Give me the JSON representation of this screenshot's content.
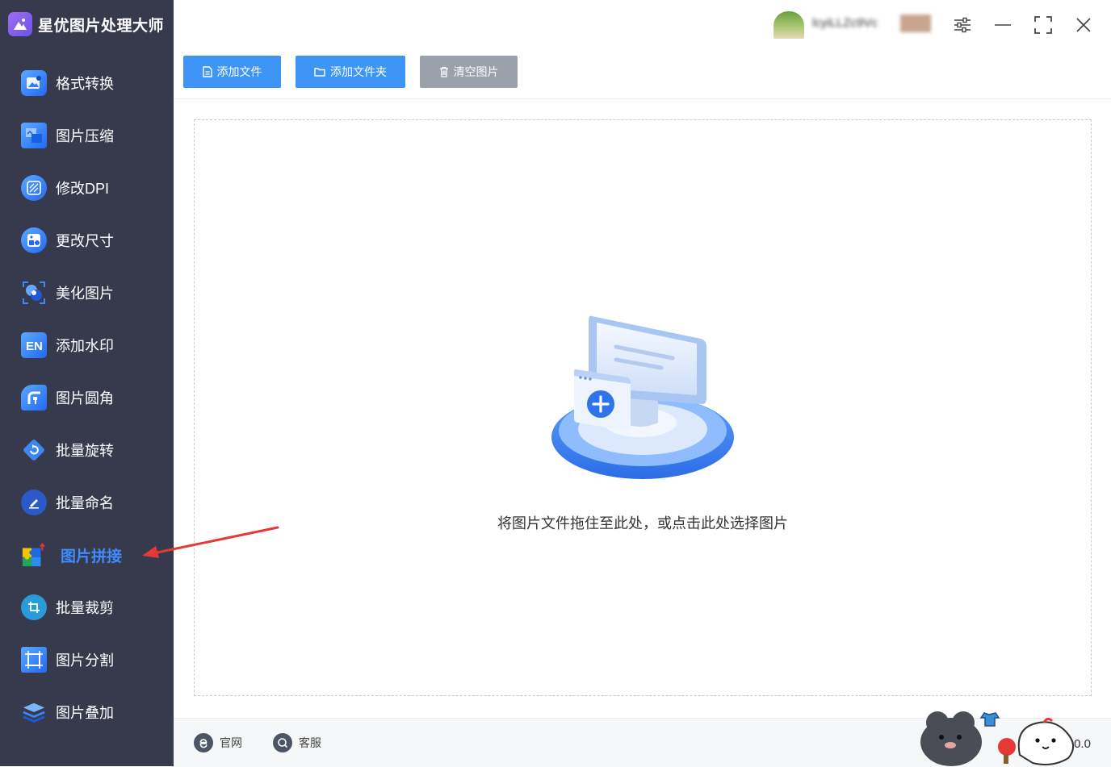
{
  "app": {
    "title": "星优图片处理大师"
  },
  "sidebar": {
    "items": [
      {
        "label": "格式转换",
        "icon": "image-convert-icon"
      },
      {
        "label": "图片压缩",
        "icon": "image-compress-icon"
      },
      {
        "label": "修改DPI",
        "icon": "dpi-icon"
      },
      {
        "label": "更改尺寸",
        "icon": "resize-icon"
      },
      {
        "label": "美化图片",
        "icon": "beautify-icon"
      },
      {
        "label": "添加水印",
        "icon": "watermark-icon"
      },
      {
        "label": "图片圆角",
        "icon": "rounded-corner-icon"
      },
      {
        "label": "批量旋转",
        "icon": "rotate-icon"
      },
      {
        "label": "批量命名",
        "icon": "rename-icon"
      },
      {
        "label": "图片拼接",
        "icon": "puzzle-icon",
        "active": true
      },
      {
        "label": "批量裁剪",
        "icon": "crop-icon"
      },
      {
        "label": "图片分割",
        "icon": "split-icon"
      },
      {
        "label": "图片叠加",
        "icon": "layers-icon"
      }
    ]
  },
  "header": {
    "username": "lcyiLLZc9Vc"
  },
  "toolbar": {
    "add_file": "添加文件",
    "add_folder": "添加文件夹",
    "clear": "清空图片"
  },
  "dropzone": {
    "hint": "将图片文件拖住至此处，或点击此处选择图片"
  },
  "footer": {
    "website": "官网",
    "support": "客服",
    "version": "版 .0.0"
  },
  "colors": {
    "sidebar_bg": "#363a4c",
    "accent": "#3f95f5",
    "active_label": "#3f8cff",
    "clear_button": "#9aa1aa",
    "arrow": "#e53935"
  }
}
